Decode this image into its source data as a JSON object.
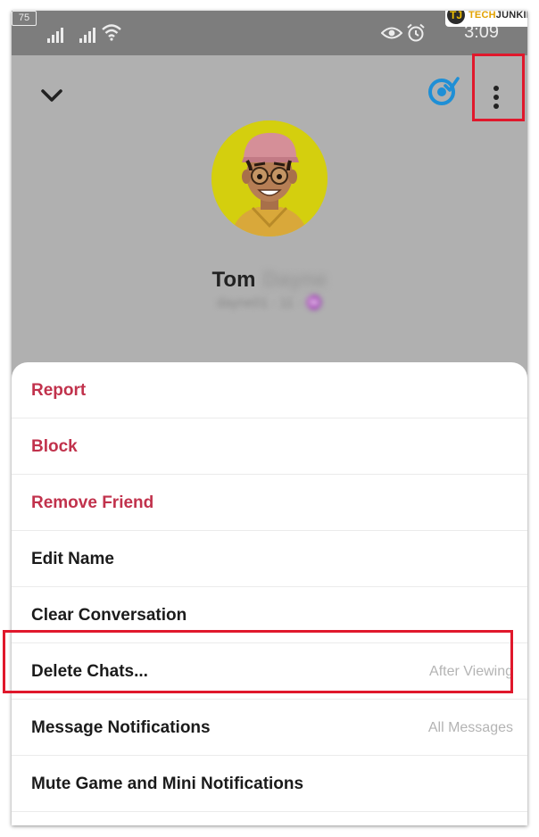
{
  "status_bar": {
    "time": "3:09",
    "battery": "75",
    "icons": [
      "signal-icon",
      "signal-icon",
      "wifi-icon",
      "eye-icon",
      "alarm-icon",
      "battery-icon"
    ]
  },
  "watermark": {
    "logo_letters": "TJ",
    "prefix": "TECH",
    "suffix": "JUNKIE"
  },
  "header": {
    "back_icon": "chevron-down-icon",
    "bitmoji_icon": "bitmoji-action-icon",
    "more_icon": "more-vertical-icon"
  },
  "profile": {
    "first_name": "Tom",
    "last_name": "Dayne",
    "username": "dayne01 · 11 · ♒"
  },
  "menu": {
    "items": [
      {
        "label": "Report",
        "value": "",
        "danger": true
      },
      {
        "label": "Block",
        "value": "",
        "danger": true
      },
      {
        "label": "Remove Friend",
        "value": "",
        "danger": true
      },
      {
        "label": "Edit Name",
        "value": "",
        "danger": false
      },
      {
        "label": "Clear Conversation",
        "value": "",
        "danger": false
      },
      {
        "label": "Delete Chats...",
        "value": "After Viewing",
        "danger": false
      },
      {
        "label": "Message Notifications",
        "value": "All Messages",
        "danger": false
      },
      {
        "label": "Mute Game and Mini Notifications",
        "value": "",
        "danger": false
      }
    ]
  },
  "colors": {
    "danger": "#c1324c",
    "highlight": "#e0182c",
    "avatar_bg": "#d4cf0e",
    "accent_blue": "#1e8fd6"
  }
}
